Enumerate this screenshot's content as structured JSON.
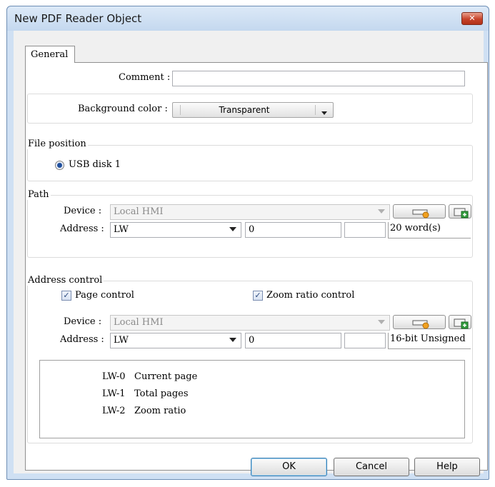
{
  "window": {
    "title": "New PDF Reader Object",
    "close_glyph": "✕"
  },
  "tabs": [
    {
      "label": "General"
    }
  ],
  "comment": {
    "label": "Comment :",
    "value": ""
  },
  "background": {
    "label": "Background color :",
    "value": "Transparent"
  },
  "file_position": {
    "legend": "File position",
    "option": "USB disk 1"
  },
  "path": {
    "legend": "Path",
    "device_label": "Device :",
    "device_value": "Local HMI",
    "address_label": "Address :",
    "address_type": "LW",
    "address_value": "0",
    "address_extra": "",
    "size_text": "20 word(s)"
  },
  "address_control": {
    "legend": "Address control",
    "page_control_label": "Page control",
    "page_control_checked": true,
    "zoom_control_label": "Zoom ratio control",
    "zoom_control_checked": true,
    "device_label": "Device :",
    "device_value": "Local HMI",
    "address_label": "Address :",
    "address_type": "LW",
    "address_value": "0",
    "address_extra": "",
    "format_text": "16-bit Unsigned",
    "info_rows": [
      {
        "address": "LW-0",
        "desc": "Current page"
      },
      {
        "address": "LW-1",
        "desc": "Total pages"
      },
      {
        "address": "LW-2",
        "desc": "Zoom ratio"
      }
    ]
  },
  "buttons": {
    "ok": "OK",
    "cancel": "Cancel",
    "help": "Help"
  },
  "icons": {
    "address_settings": "address-settings-icon",
    "add_address": "add-address-icon"
  },
  "colors": {
    "window_frame": "#cfe0f3",
    "close_button": "#c7432a",
    "icon_orange": "#f0a020",
    "icon_green": "#2f9a3a"
  }
}
